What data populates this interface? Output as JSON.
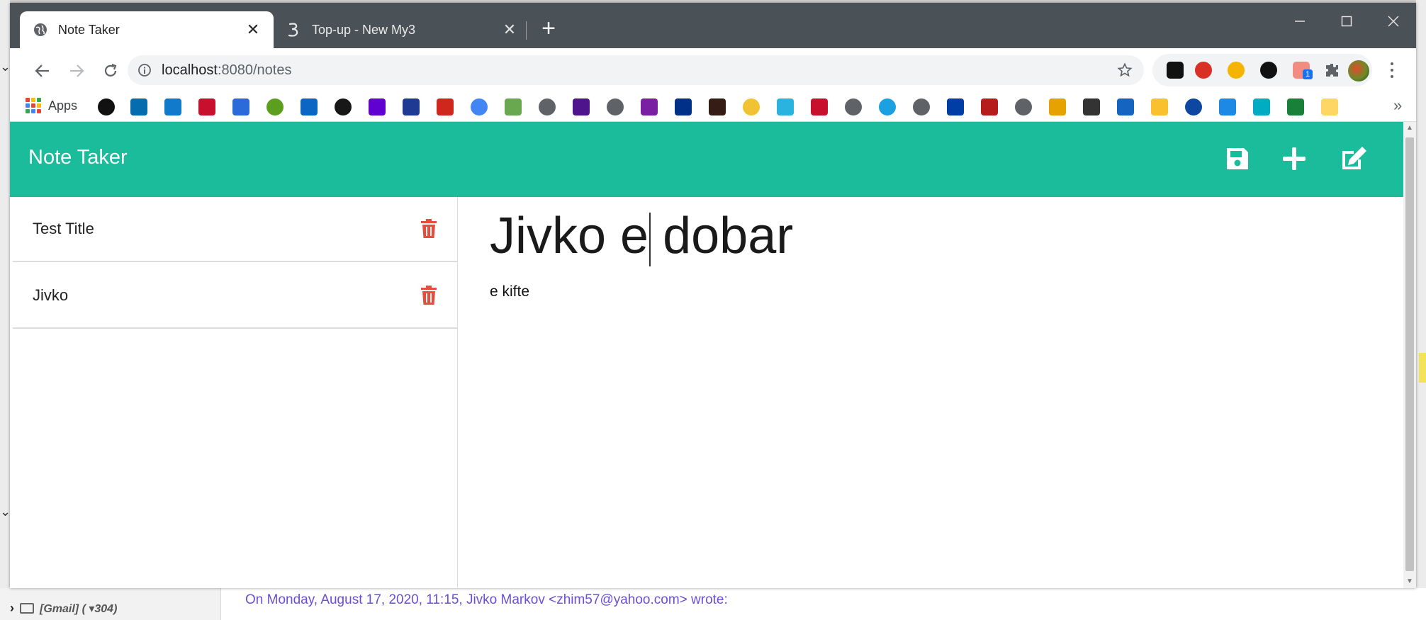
{
  "browser": {
    "tabs": [
      {
        "title": "Note Taker",
        "close": "✕"
      },
      {
        "title": "Top-up - New My3",
        "close": "✕"
      }
    ],
    "new_tab": "+",
    "window_controls": {
      "minimize": "minimize-icon",
      "maximize": "maximize-icon",
      "close": "close-icon"
    },
    "address": {
      "host": "localhost",
      "path": ":8080/notes"
    },
    "bookmarks_bar": {
      "apps_label": "Apps",
      "overflow": "»"
    },
    "extensions": [
      "tab-icon",
      "adblock-icon",
      "globe-icon",
      "chat-icon",
      "notification-icon",
      "puzzle-icon"
    ],
    "extension_badge": "1"
  },
  "app": {
    "brand": "Note Taker",
    "actions": [
      "save-icon",
      "plus-icon",
      "edit-icon"
    ],
    "accent_color": "#1abc9c",
    "delete_color": "#e74c3c",
    "notes": [
      {
        "title": "Test Title"
      },
      {
        "title": "Jivko"
      }
    ],
    "active_note": {
      "title": "Jivko e dobar",
      "body": "e kifte"
    }
  },
  "background": {
    "folder_label": "[Gmail] ( ▾304)",
    "quoted_line": "On Monday, August 17, 2020, 11:15, Jivko Markov <zhim57@yahoo.com> wrote:"
  }
}
